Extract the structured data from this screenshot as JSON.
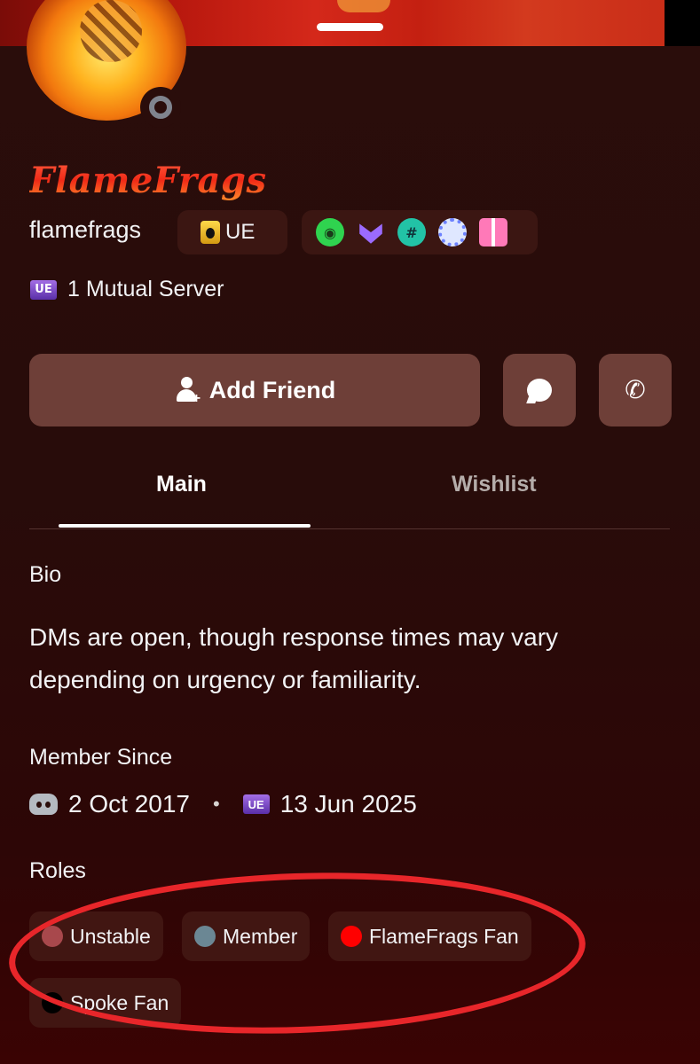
{
  "profile": {
    "display_name": "FlameFrags",
    "username": "flamefrags",
    "server_tag": "UE",
    "status": "offline",
    "badges": [
      "nitro-icon",
      "boost-icon",
      "hash-icon",
      "quest-icon",
      "gift-icon"
    ]
  },
  "mutual": {
    "label": "1 Mutual Server",
    "server_icon_text": "UE"
  },
  "actions": {
    "add_friend_label": "Add Friend"
  },
  "tabs": {
    "main": "Main",
    "wishlist": "Wishlist",
    "active": "Main"
  },
  "bio": {
    "heading": "Bio",
    "text": "DMs are open, though response times may vary depending on urgency or familiarity."
  },
  "member_since": {
    "heading": "Member Since",
    "discord_date": "2 Oct 2017",
    "separator": "•",
    "server_icon_text": "UE",
    "server_date": "13 Jun 2025"
  },
  "roles": {
    "heading": "Roles",
    "items": [
      {
        "name": "Unstable",
        "color": "#a8484c"
      },
      {
        "name": "Member",
        "color": "#6b8794"
      },
      {
        "name": "FlameFrags Fan",
        "color": "#ff0000"
      },
      {
        "name": "Spoke Fan",
        "color": "#000000"
      }
    ]
  },
  "colors": {
    "background": "#2a0d0b",
    "button": "#6e3f38",
    "pill": "#3b1612",
    "annotation": "#e8262a",
    "display_name": "#f02a17"
  }
}
